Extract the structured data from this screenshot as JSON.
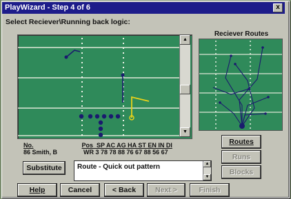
{
  "window": {
    "title": "PlayWizard - Step 4 of 6",
    "close_label": "x"
  },
  "prompt": "Select Reciever\\Running back logic:",
  "routes_panel": {
    "title": "Reciever Routes"
  },
  "stats": {
    "header": {
      "no": "No.",
      "stats": "Pos  SP AC AG HA ST EN IN DI"
    },
    "player": {
      "no": "86 Smith, B",
      "stats": "WR 3 78 78 88 76 67 88 56 67"
    }
  },
  "route_description": "Route - Quick out pattern",
  "buttons": {
    "routes": "Routes",
    "runs": "Runs",
    "blocks": "Blocks",
    "substitute": "Substitute",
    "help": "Help",
    "cancel": "Cancel",
    "back": "< Back",
    "next": "Next >",
    "finish": "Finish"
  },
  "colors": {
    "field": "#2f8a5a",
    "title_bar": "#1d1c8a",
    "selected_route": "#e8d21a",
    "player": "#1a1a6e"
  }
}
